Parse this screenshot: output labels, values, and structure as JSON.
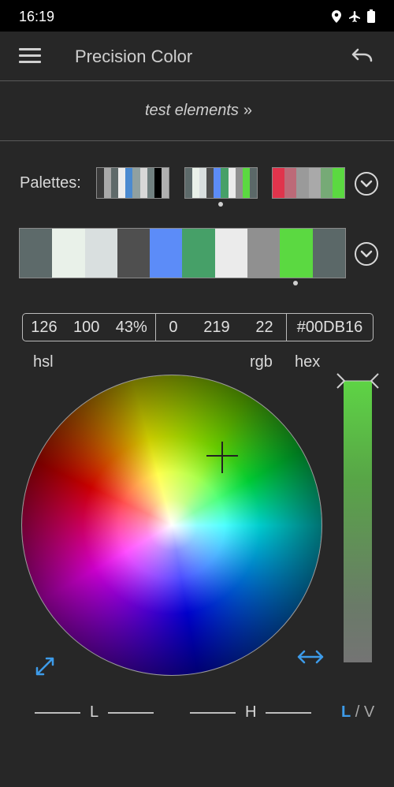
{
  "status_bar": {
    "time": "16:19",
    "icons": [
      "location-icon",
      "airplane-icon",
      "battery-icon"
    ]
  },
  "app_bar": {
    "title": "Precision Color",
    "icons": [
      "menu-icon",
      "undo-icon"
    ]
  },
  "subtitle": {
    "label": "test elements",
    "chevron": "»"
  },
  "palettes": {
    "label": "Palettes:",
    "thumbnails": [
      {
        "colors": [
          "#3a3a3a",
          "#a9a9a9",
          "#5f6a6a",
          "#ececec",
          "#4b8ad0",
          "#90a0a0",
          "#d8d8d8",
          "#708080",
          "#000000",
          "#b0b0b0"
        ]
      },
      {
        "colors": [
          "#5d6a6a",
          "#e9f1e9",
          "#d9dfdf",
          "#4f4f4f",
          "#5c8cf8",
          "#46a068",
          "#ebebeb",
          "#909090",
          "#5bd941",
          "#5b6868"
        ],
        "selected": true
      },
      {
        "colors": [
          "#e0344c",
          "#bc6a78",
          "#9a9a9a",
          "#a9a9a9",
          "#76aa76",
          "#5bd941"
        ]
      }
    ],
    "icons": [
      "chevron-down-circle-icon",
      "chevron-down-circle-icon"
    ]
  },
  "current_palette": {
    "swatches": [
      "#5d6a6a",
      "#e9f1e9",
      "#d9dfdf",
      "#4f4f4f",
      "#5c8cf8",
      "#46a068",
      "#ebebeb",
      "#909090",
      "#5bd941",
      "#5b6868"
    ],
    "selected_index": 8
  },
  "values": {
    "hsl": {
      "h": "126",
      "s": "100",
      "l": "43%"
    },
    "rgb": {
      "r": "0",
      "g": "219",
      "b": "22"
    },
    "hex": "#00DB16"
  },
  "labels": {
    "hsl": "hsl",
    "rgb": "rgb",
    "hex": "hex"
  },
  "bottom": {
    "axis_l": "L",
    "axis_h": "H",
    "mode_active": "L",
    "mode_sep": "/",
    "mode_inactive": "V",
    "icons": [
      "expand-icon",
      "swap-horizontal-icon"
    ]
  },
  "colors": {
    "accent": "#3d9be9",
    "background": "#272727",
    "selected_color": "#00DB16"
  }
}
